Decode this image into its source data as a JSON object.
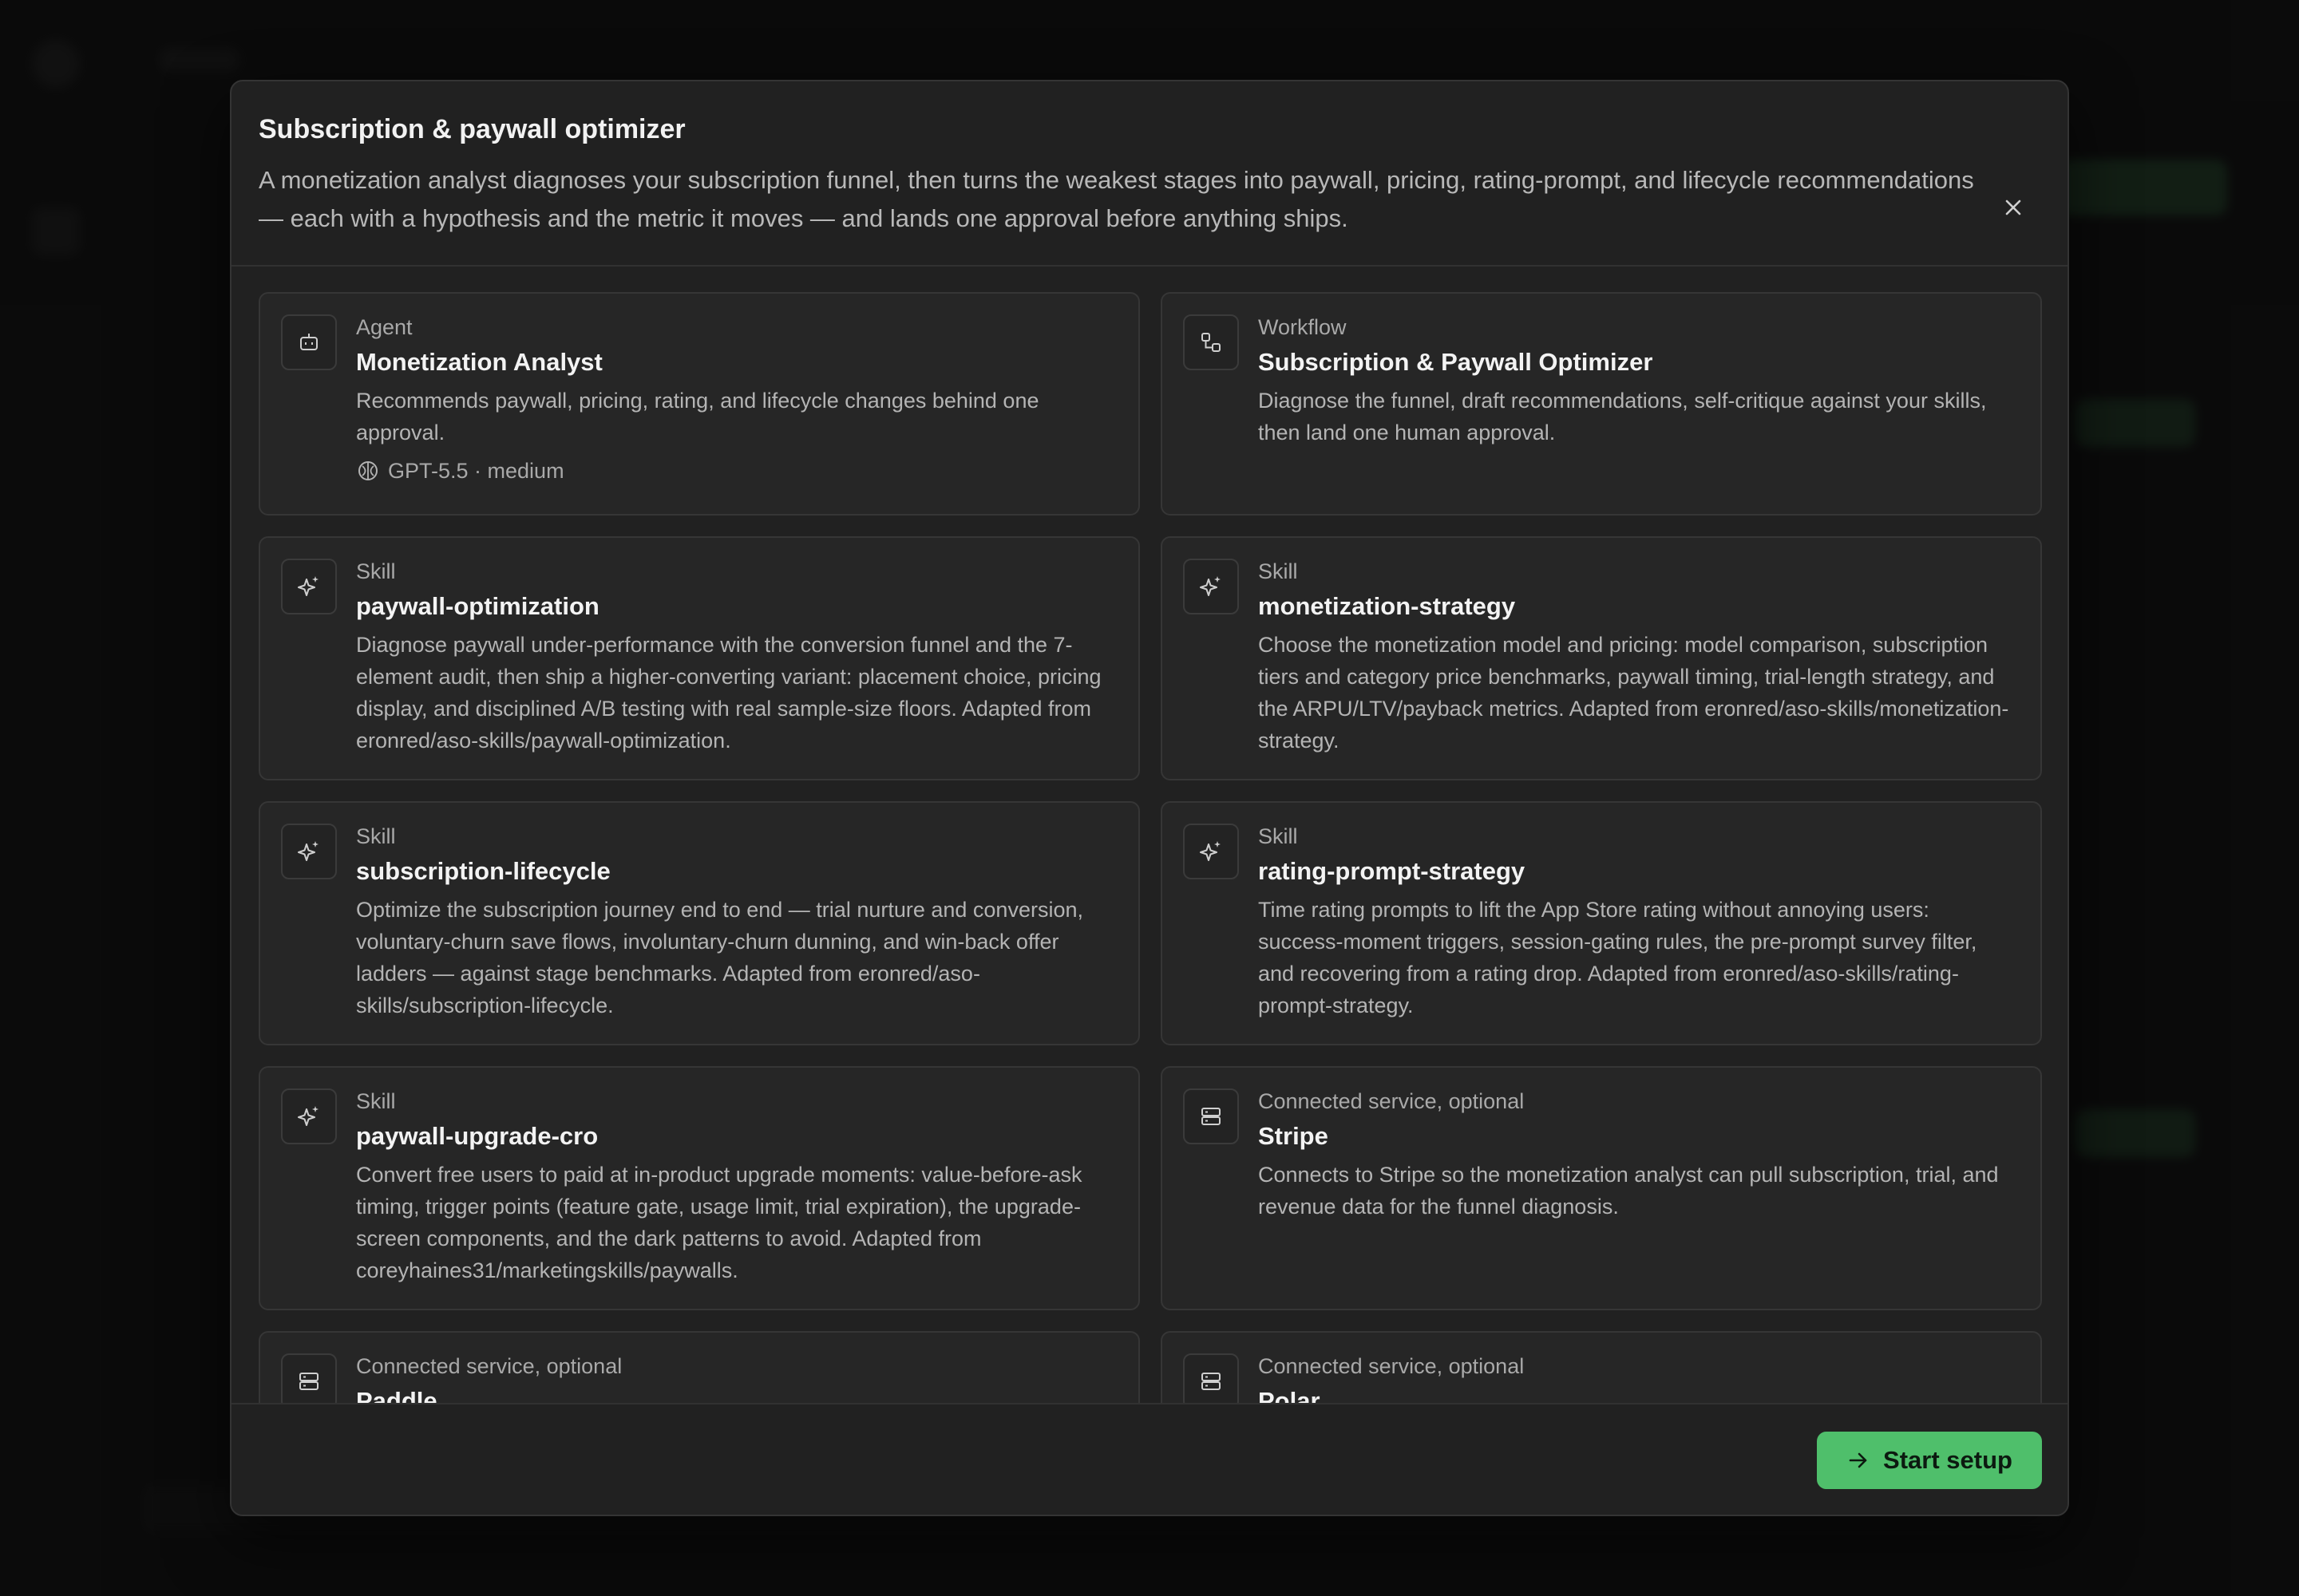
{
  "modal": {
    "title": "Subscription & paywall optimizer",
    "description": "A monetization analyst diagnoses your subscription funnel, then turns the weakest stages into paywall, pricing, rating-prompt, and lifecycle recommendations — each with a hypothesis and the metric it moves — and lands one approval before anything ships.",
    "close_icon": "close-icon",
    "start_button_label": "Start setup",
    "start_button_icon": "arrow-right-icon",
    "accent_color": "#4fbf6b"
  },
  "cards": [
    {
      "icon": "robot-icon",
      "kind": "Agent",
      "title": "Monetization Analyst",
      "text": "Recommends paywall, pricing, rating, and lifecycle changes behind one approval.",
      "meta_icon": "model-icon",
      "meta": "GPT-5.5 · medium"
    },
    {
      "icon": "workflow-icon",
      "kind": "Workflow",
      "title": "Subscription & Paywall Optimizer",
      "text": "Diagnose the funnel, draft recommendations, self-critique against your skills, then land one human approval."
    },
    {
      "icon": "sparkle-icon",
      "kind": "Skill",
      "title": "paywall-optimization",
      "text": "Diagnose paywall under-performance with the conversion funnel and the 7-element audit, then ship a higher-converting variant: placement choice, pricing display, and disciplined A/B testing with real sample-size floors. Adapted from eronred/aso-skills/paywall-optimization."
    },
    {
      "icon": "sparkle-icon",
      "kind": "Skill",
      "title": "monetization-strategy",
      "text": "Choose the monetization model and pricing: model comparison, subscription tiers and category price benchmarks, paywall timing, trial-length strategy, and the ARPU/LTV/payback metrics. Adapted from eronred/aso-skills/monetization-strategy."
    },
    {
      "icon": "sparkle-icon",
      "kind": "Skill",
      "title": "subscription-lifecycle",
      "text": "Optimize the subscription journey end to end — trial nurture and conversion, voluntary-churn save flows, involuntary-churn dunning, and win-back offer ladders — against stage benchmarks. Adapted from eronred/aso-skills/subscription-lifecycle."
    },
    {
      "icon": "sparkle-icon",
      "kind": "Skill",
      "title": "rating-prompt-strategy",
      "text": "Time rating prompts to lift the App Store rating without annoying users: success-moment triggers, session-gating rules, the pre-prompt survey filter, and recovering from a rating drop. Adapted from eronred/aso-skills/rating-prompt-strategy."
    },
    {
      "icon": "sparkle-icon",
      "kind": "Skill",
      "title": "paywall-upgrade-cro",
      "text": "Convert free users to paid at in-product upgrade moments: value-before-ask timing, trigger points (feature gate, usage limit, trial expiration), the upgrade-screen components, and the dark patterns to avoid. Adapted from coreyhaines31/marketingskills/paywalls."
    },
    {
      "icon": "server-icon",
      "kind": "Connected service, optional",
      "title": "Stripe",
      "text": "Connects to Stripe so the monetization analyst can pull subscription, trial, and revenue data for the funnel diagnosis."
    },
    {
      "icon": "server-icon",
      "kind": "Connected service, optional",
      "title": "Paddle",
      "text": ""
    },
    {
      "icon": "server-icon",
      "kind": "Connected service, optional",
      "title": "Polar",
      "text": ""
    }
  ]
}
